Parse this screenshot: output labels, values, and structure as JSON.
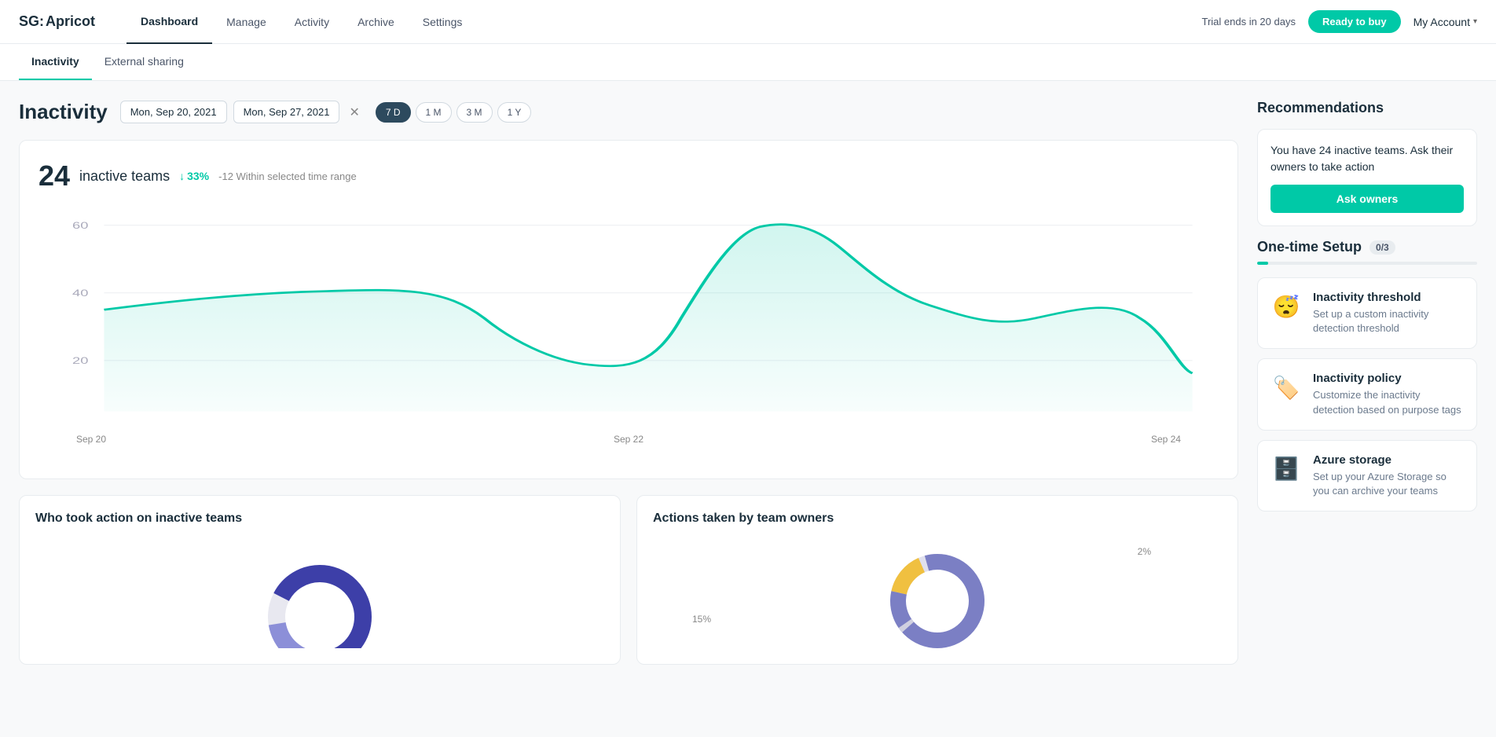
{
  "header": {
    "logo_sg": "SG:",
    "logo_apricot": "Apricot",
    "nav": [
      {
        "label": "Dashboard",
        "active": true
      },
      {
        "label": "Manage",
        "active": false
      },
      {
        "label": "Activity",
        "active": false
      },
      {
        "label": "Archive",
        "active": false
      },
      {
        "label": "Settings",
        "active": false
      }
    ],
    "trial_text": "Trial ends in 20 days",
    "ready_to_buy_label": "Ready to buy",
    "my_account_label": "My Account"
  },
  "sub_nav": [
    {
      "label": "Inactivity",
      "active": true
    },
    {
      "label": "External sharing",
      "active": false
    }
  ],
  "page": {
    "title": "Inactivity",
    "date_from": "Mon, Sep 20, 2021",
    "date_to": "Mon, Sep 27, 2021",
    "periods": [
      {
        "label": "7 D",
        "active": true
      },
      {
        "label": "1 M",
        "active": false
      },
      {
        "label": "3 M",
        "active": false
      },
      {
        "label": "1 Y",
        "active": false
      }
    ]
  },
  "chart": {
    "inactive_count": "24",
    "inactive_label": "inactive teams",
    "trend_pct": "33%",
    "trend_direction": "down",
    "trend_arrow": "↓",
    "trend_desc": "-12 Within selected time range",
    "y_labels": [
      "60",
      "40",
      "20"
    ],
    "x_labels": [
      "Sep 20",
      "Sep 22",
      "Sep 24"
    ]
  },
  "bottom_cards": [
    {
      "title": "Who took action on inactive teams"
    },
    {
      "title": "Actions taken by team owners",
      "legend": [
        {
          "label": "2%",
          "color": "#c8c8d8"
        },
        {
          "label": "15%",
          "color": "#f0c040"
        }
      ]
    }
  ],
  "sidebar": {
    "recommendations_title": "Recommendations",
    "rec_card": {
      "text": "You have 24 inactive teams. Ask their owners to take action",
      "button_label": "Ask owners"
    },
    "one_time_setup": {
      "title": "One-time Setup",
      "badge": "0/3",
      "progress_pct": 5
    },
    "setup_cards": [
      {
        "id": "threshold",
        "icon": "😴",
        "title": "Inactivity threshold",
        "desc": "Set up a custom inactivity detection threshold"
      },
      {
        "id": "policy",
        "icon": "🏷️",
        "title": "Inactivity policy",
        "desc": "Customize the inactivity detection based on purpose tags"
      },
      {
        "id": "azure",
        "icon": "🗄️",
        "title": "Azure storage",
        "desc": "Set up your Azure Storage so you can archive your teams"
      }
    ]
  }
}
